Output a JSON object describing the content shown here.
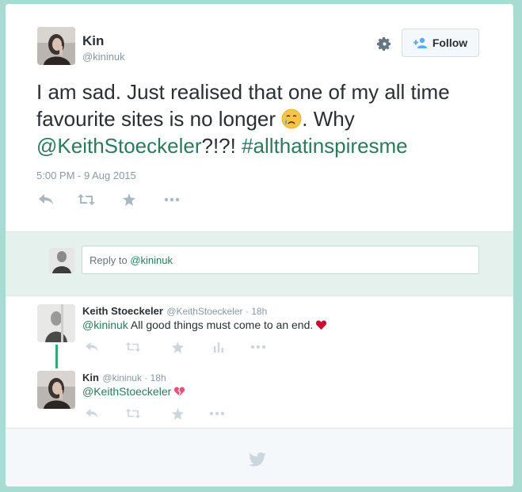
{
  "tweet": {
    "author_name": "Kin",
    "author_handle": "@kininuk",
    "follow_label": "Follow",
    "text_part1": "I am sad. Just realised that one of my all time favourite sites is no longer ",
    "text_part2": ". Why ",
    "mention": "@KeithStoeckeler",
    "text_part3": "?!?! ",
    "hashtag": "#allthatinspiresme",
    "timestamp": "5:00 PM - 9 Aug 2015"
  },
  "reply_box": {
    "label": "Reply to ",
    "handle": "@kininuk"
  },
  "replies": [
    {
      "name": "Keith Stoeckeler",
      "meta": "@KeithStoeckeler · 18h",
      "mention": "@kininuk",
      "text": " All good things must come to an end. ",
      "emoji": "red-heart"
    },
    {
      "name": "Kin",
      "meta": "@kininuk · 18h",
      "mention": "@KeithStoeckeler",
      "text": " ",
      "emoji": "broken-heart"
    }
  ],
  "icons": [
    "gear-icon",
    "follow-person-icon",
    "reply-icon",
    "retweet-icon",
    "favorite-icon",
    "more-icon",
    "analytics-icon",
    "twitter-bird-icon",
    "crying-face-emoji"
  ],
  "colors": {
    "background": "#a8dcd3",
    "link": "#2b7a5a",
    "muted": "#8899a6",
    "reply_area": "#e5f1ed",
    "thread_line": "#3aa57a"
  }
}
